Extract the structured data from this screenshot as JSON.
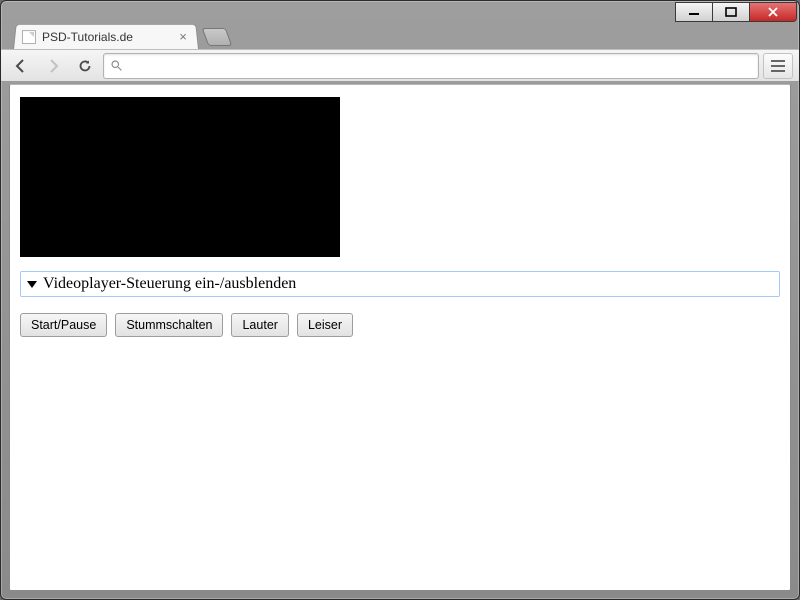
{
  "tab": {
    "title": "PSD-Tutorials.de"
  },
  "toolbar": {
    "url_value": ""
  },
  "page": {
    "details_summary": "Videoplayer-Steuerung ein-/ausblenden",
    "buttons": {
      "play_pause": "Start/Pause",
      "mute": "Stummschalten",
      "louder": "Lauter",
      "quieter": "Leiser"
    }
  }
}
